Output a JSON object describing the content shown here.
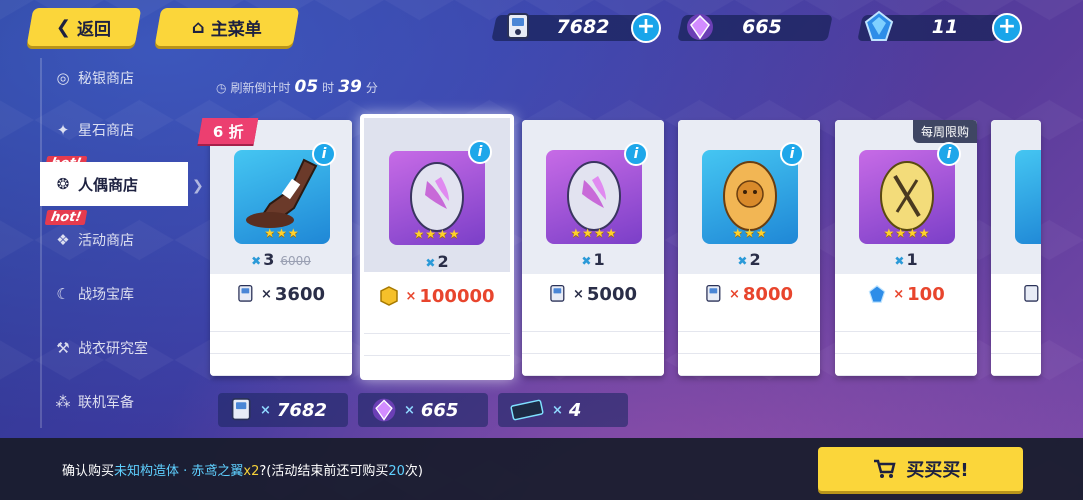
{
  "nav": {
    "back_label": "返回",
    "menu_label": "主菜单"
  },
  "currencies": [
    {
      "icon": "ticket-icon",
      "value": "7682"
    },
    {
      "icon": "crystal-icon",
      "value": "665"
    },
    {
      "icon": "star-stone-icon",
      "value": "11"
    }
  ],
  "sidebar": {
    "items": [
      {
        "label": "秘银商店",
        "icon": "mithril-icon",
        "hot": ""
      },
      {
        "label": "星石商店",
        "icon": "star-stone-icon",
        "hot": ""
      },
      {
        "label": "人偶商店",
        "icon": "doll-icon",
        "hot": "hot!",
        "active": true
      },
      {
        "label": "活动商店",
        "icon": "event-icon",
        "hot": "hot!"
      },
      {
        "label": "战场宝库",
        "icon": "moon-icon",
        "hot": ""
      },
      {
        "label": "战衣研究室",
        "icon": "hammer-icon",
        "hot": ""
      },
      {
        "label": "联机军备",
        "icon": "multiplayer-icon",
        "hot": ""
      }
    ]
  },
  "timer": {
    "label": "刷新倒计时",
    "hours": "05",
    "hours_unit": "时",
    "minutes": "39",
    "minutes_unit": "分"
  },
  "discount_badge": "6 折",
  "weekly_limit": "每周限购",
  "cards": [
    {
      "item": "bottle",
      "stars": "★★★",
      "qty": "3",
      "old_price": "6000",
      "currency": "ticket-icon",
      "price": "3600",
      "price_color": "dark"
    },
    {
      "item": "purple-egg",
      "stars": "★★★★",
      "qty": "2",
      "old_price": "",
      "currency": "gold-coin-icon",
      "price": "100000",
      "price_color": "red",
      "selected": true
    },
    {
      "item": "purple-egg",
      "stars": "★★★★",
      "qty": "1",
      "old_price": "",
      "currency": "ticket-icon",
      "price": "5000",
      "price_color": "dark"
    },
    {
      "item": "orange-egg",
      "stars": "★★★",
      "qty": "2",
      "old_price": "",
      "currency": "ticket-icon",
      "price": "8000",
      "price_color": "red"
    },
    {
      "item": "gold-egg",
      "stars": "★★★★",
      "qty": "1",
      "old_price": "",
      "currency": "star-stone-icon",
      "price": "100",
      "price_color": "red"
    }
  ],
  "resources": [
    {
      "icon": "ticket-icon",
      "value": "7682"
    },
    {
      "icon": "crystal-icon",
      "value": "665"
    },
    {
      "icon": "card-ticket-icon",
      "value": "4"
    }
  ],
  "confirm": {
    "prefix": "确认购买",
    "item_name": "未知构造体 · 赤鸢之翼",
    "multiplier": "x2",
    "middle": "?(活动结束前还可购买",
    "remaining": "20",
    "suffix": "次)",
    "buy_label": "买买买!"
  },
  "colors": {
    "accent_yellow": "#fbd63a",
    "info_blue": "#1ea7ea",
    "price_red": "#e8452d",
    "discount_pink": "#ec3f70"
  }
}
